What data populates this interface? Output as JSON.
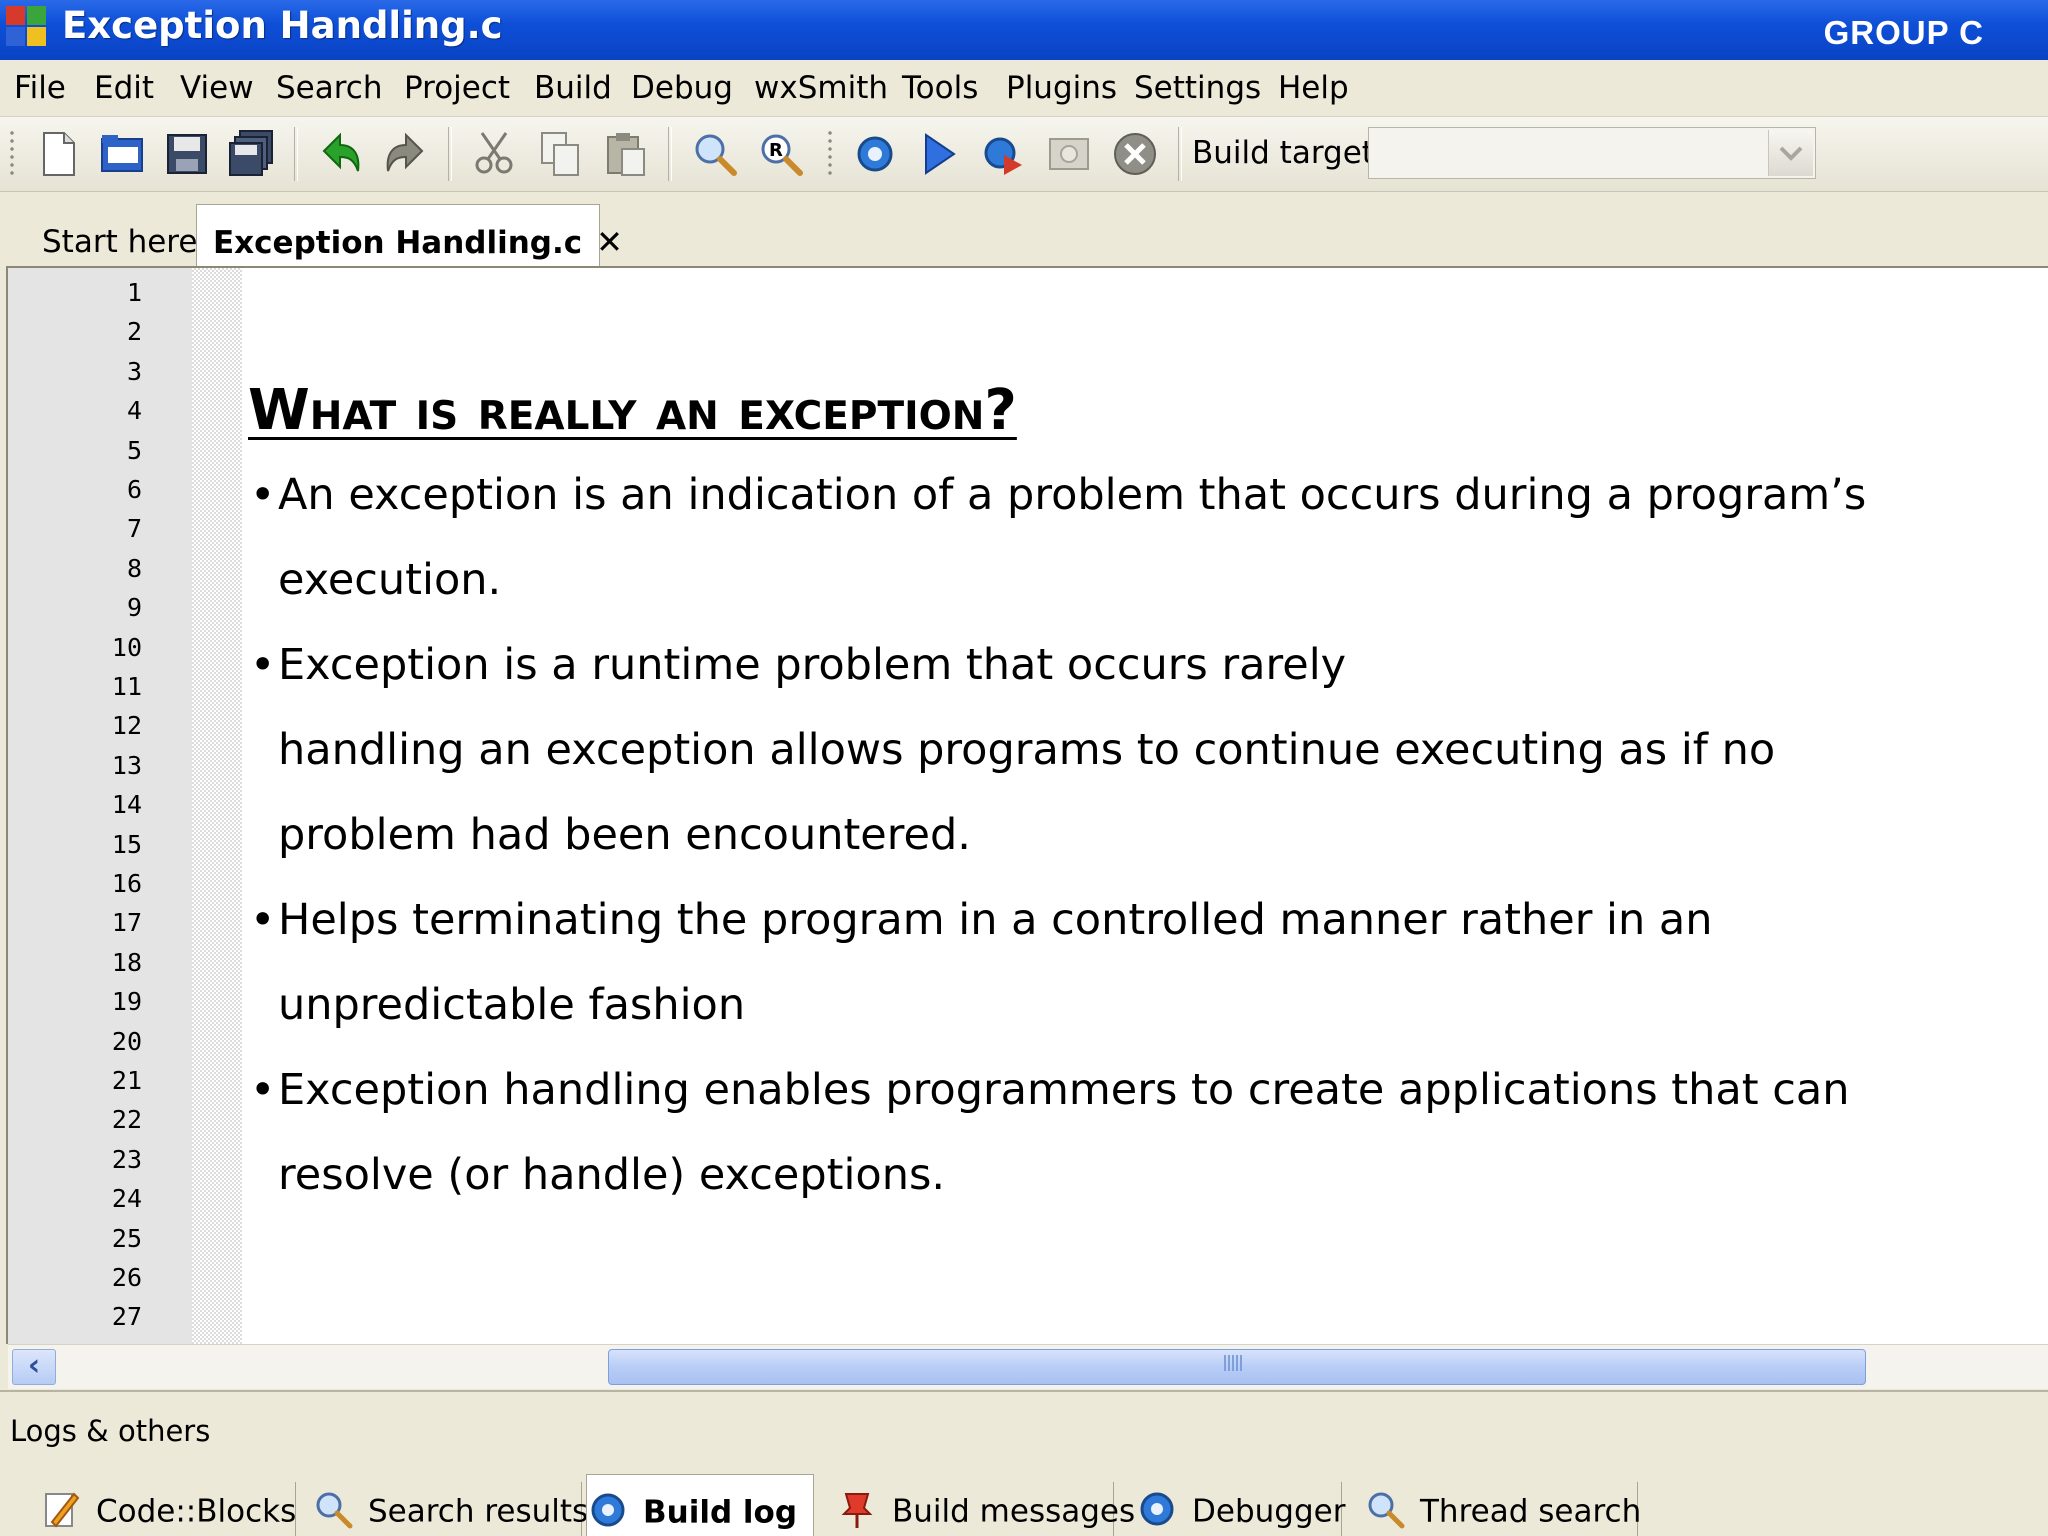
{
  "window": {
    "title": "Exception Handling.c",
    "group_label": "GROUP C"
  },
  "menu": {
    "items": [
      "File",
      "Edit",
      "View",
      "Search",
      "Project",
      "Build",
      "Debug",
      "wxSmith",
      "Tools",
      "Plugins",
      "Settings",
      "Help"
    ]
  },
  "toolbar": {
    "build_target_label": "Build target:",
    "build_target_value": ""
  },
  "tabs": {
    "start": "Start here",
    "active": "Exception Handling.c",
    "close_glyph": "✕"
  },
  "editor": {
    "line_numbers": [
      "1",
      "2",
      "3",
      "4",
      "5",
      "6",
      "7",
      "8",
      "9",
      "10",
      "11",
      "12",
      "13",
      "14",
      "15",
      "16",
      "17",
      "18",
      "19",
      "20",
      "21",
      "22",
      "23",
      "24",
      "25",
      "26",
      "27"
    ],
    "heading": "What is really an exception?",
    "bullets": [
      {
        "lines": [
          "An exception  is an indication of a problem that occurs during a program’s",
          "execution."
        ]
      },
      {
        "lines": [
          "Exception is a runtime problem that occurs rarely",
          "handling an exception allows programs to continue executing as if no",
          "problem had been encountered."
        ]
      },
      {
        "lines": [
          "Helps terminating the program in a controlled manner rather in an",
          "unpredictable fashion"
        ]
      },
      {
        "lines": [
          "Exception handling enables programmers to create applications that can",
          "resolve (or handle) exceptions."
        ]
      }
    ],
    "bullet_glyph": "•"
  },
  "bottom_panel": {
    "title": "Logs & others",
    "tabs": [
      "Code::Blocks",
      "Search results",
      "Build log",
      "Build messages",
      "Debugger",
      "Thread search"
    ],
    "active_tab": "Build log"
  },
  "colors": {
    "titlebar": "#0e4fd8",
    "chrome": "#ece9d8",
    "gutter": "#e4e4e4",
    "scroll_thumb": "#b8cdf6"
  }
}
